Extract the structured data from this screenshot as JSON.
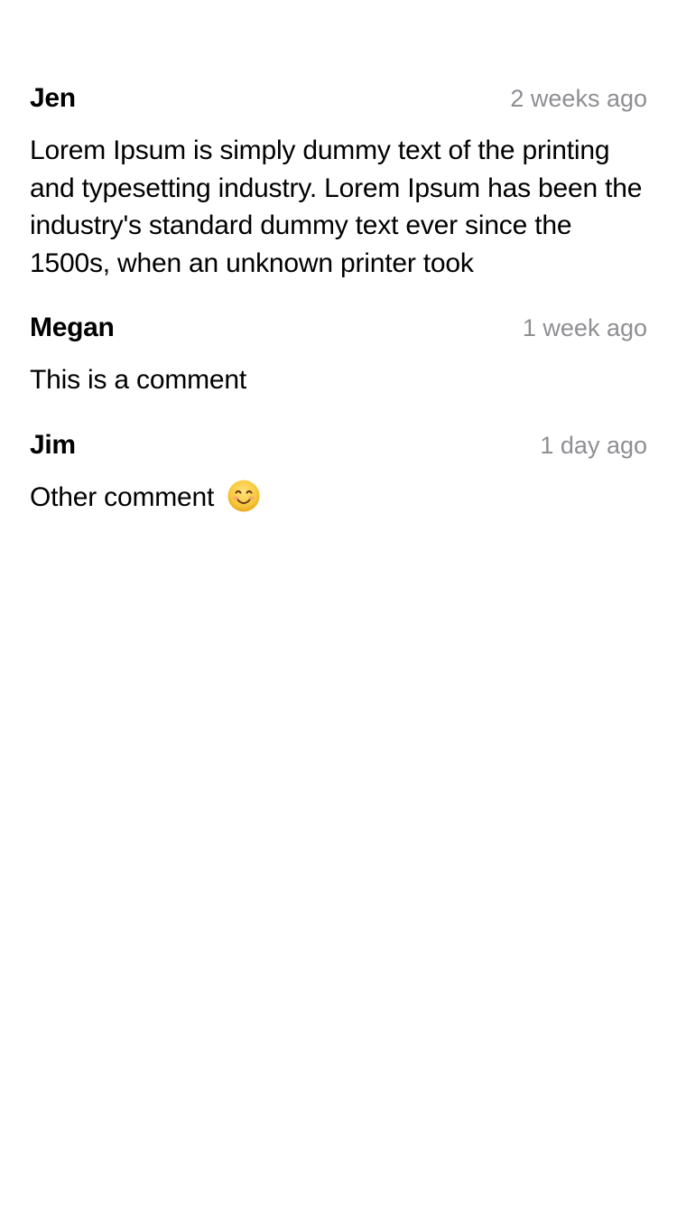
{
  "comments": [
    {
      "author": "Jen",
      "time": "2 weeks ago",
      "text": "Lorem Ipsum is simply dummy text of the printing and typesetting industry. Lorem Ipsum has been the industry's standard dummy text ever since the 1500s, when an unknown printer took"
    },
    {
      "author": "Megan",
      "time": "1 week ago",
      "text": "This is a comment"
    },
    {
      "author": "Jim",
      "time": "1 day ago",
      "text": "Other comment",
      "emoji": "smiling-face-icon"
    }
  ],
  "colors": {
    "background": "#ffffff",
    "text": "#000000",
    "timestamp": "#8e8e93",
    "emoji_face": "#f8c83c"
  }
}
